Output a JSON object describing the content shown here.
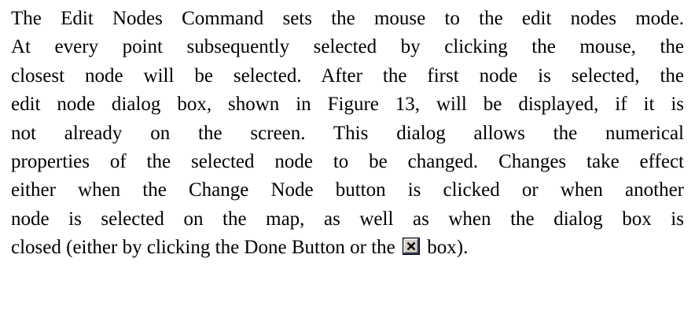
{
  "paragraph": {
    "lines": [
      "The Edit Nodes Command sets the mouse to the edit nodes mode.",
      "At every point subsequently selected by clicking the mouse, the",
      "closest node will be selected. After the first node is selected, the",
      "edit node dialog box, shown in Figure 13, will be displayed, if it is",
      "not already on the screen. This dialog allows the numerical",
      "properties of the selected node to be changed. Changes take effect",
      "either when the Change Node button is clicked or when another",
      "node is selected on the map, as well as when the dialog box is"
    ],
    "last_line_before_icon": "closed (either by clicking the Done Button or the",
    "last_line_after_icon": "box).",
    "close_box_icon": "close-box-icon"
  }
}
